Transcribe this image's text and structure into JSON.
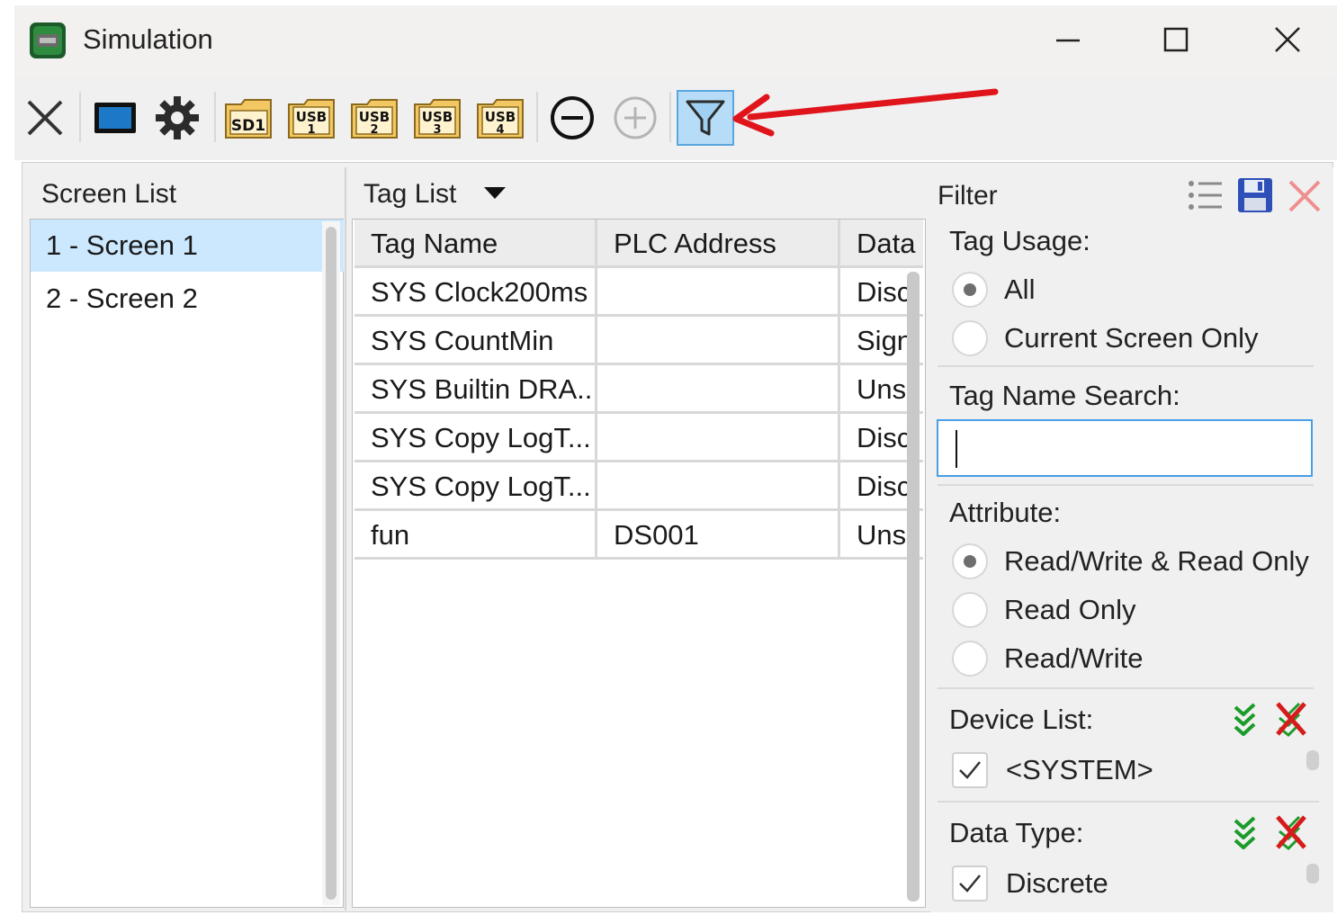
{
  "window": {
    "title": "Simulation",
    "controls": [
      "minimize-icon",
      "maximize-icon",
      "close-icon"
    ]
  },
  "toolbar": {
    "buttons": [
      {
        "name": "close-project-icon"
      },
      {
        "name": "display-icon"
      },
      {
        "name": "settings-gear-icon"
      },
      {
        "name": "sd-card-icon",
        "label": "SD1"
      },
      {
        "name": "usb1-icon",
        "label": "USB",
        "sub": "1"
      },
      {
        "name": "usb2-icon",
        "label": "USB",
        "sub": "2"
      },
      {
        "name": "usb3-icon",
        "label": "USB",
        "sub": "3"
      },
      {
        "name": "usb4-icon",
        "label": "USB",
        "sub": "4"
      },
      {
        "name": "remove-icon"
      },
      {
        "name": "add-icon",
        "disabled": true
      },
      {
        "name": "filter-icon",
        "active": true
      }
    ],
    "annotation_arrow_color": "#e0141b"
  },
  "screen_list": {
    "title": "Screen List",
    "items": [
      "1 - Screen 1",
      "2 - Screen 2"
    ],
    "selected_index": 0
  },
  "tag_list": {
    "title": "Tag List",
    "columns": [
      "Tag Name",
      "PLC Address",
      "Data Type"
    ],
    "rows": [
      {
        "name": "SYS Clock200ms",
        "address": "",
        "type": "Discrete"
      },
      {
        "name": "SYS CountMin",
        "address": "",
        "type": "Signed"
      },
      {
        "name": "SYS Builtin DRA...",
        "address": "",
        "type": "Unsigned"
      },
      {
        "name": "SYS Copy LogT...",
        "address": "",
        "type": "Discrete"
      },
      {
        "name": "SYS Copy LogT...",
        "address": "",
        "type": "Discrete"
      },
      {
        "name": "fun",
        "address": "DS001",
        "type": "Unsigned"
      }
    ]
  },
  "filter": {
    "title": "Filter",
    "tag_usage": {
      "label": "Tag Usage:",
      "options": [
        "All",
        "Current Screen Only"
      ],
      "selected": 0
    },
    "search": {
      "label": "Tag Name Search:",
      "value": ""
    },
    "attribute": {
      "label": "Attribute:",
      "options": [
        "Read/Write & Read Only",
        "Read Only",
        "Read/Write"
      ],
      "selected": 0
    },
    "device_list": {
      "label": "Device List:",
      "items": [
        {
          "label": "<SYSTEM>",
          "checked": true
        }
      ]
    },
    "data_type": {
      "label": "Data Type:",
      "items": [
        {
          "label": "Discrete",
          "checked": true
        }
      ]
    }
  },
  "colors": {
    "selection": "#cce8ff",
    "filter_active": "#b7dcf7",
    "input_focus": "#4a9ee6",
    "folder": "#f3c862",
    "check_all_green": "#1c9b2a",
    "uncheck_red": "#d61b1b"
  }
}
